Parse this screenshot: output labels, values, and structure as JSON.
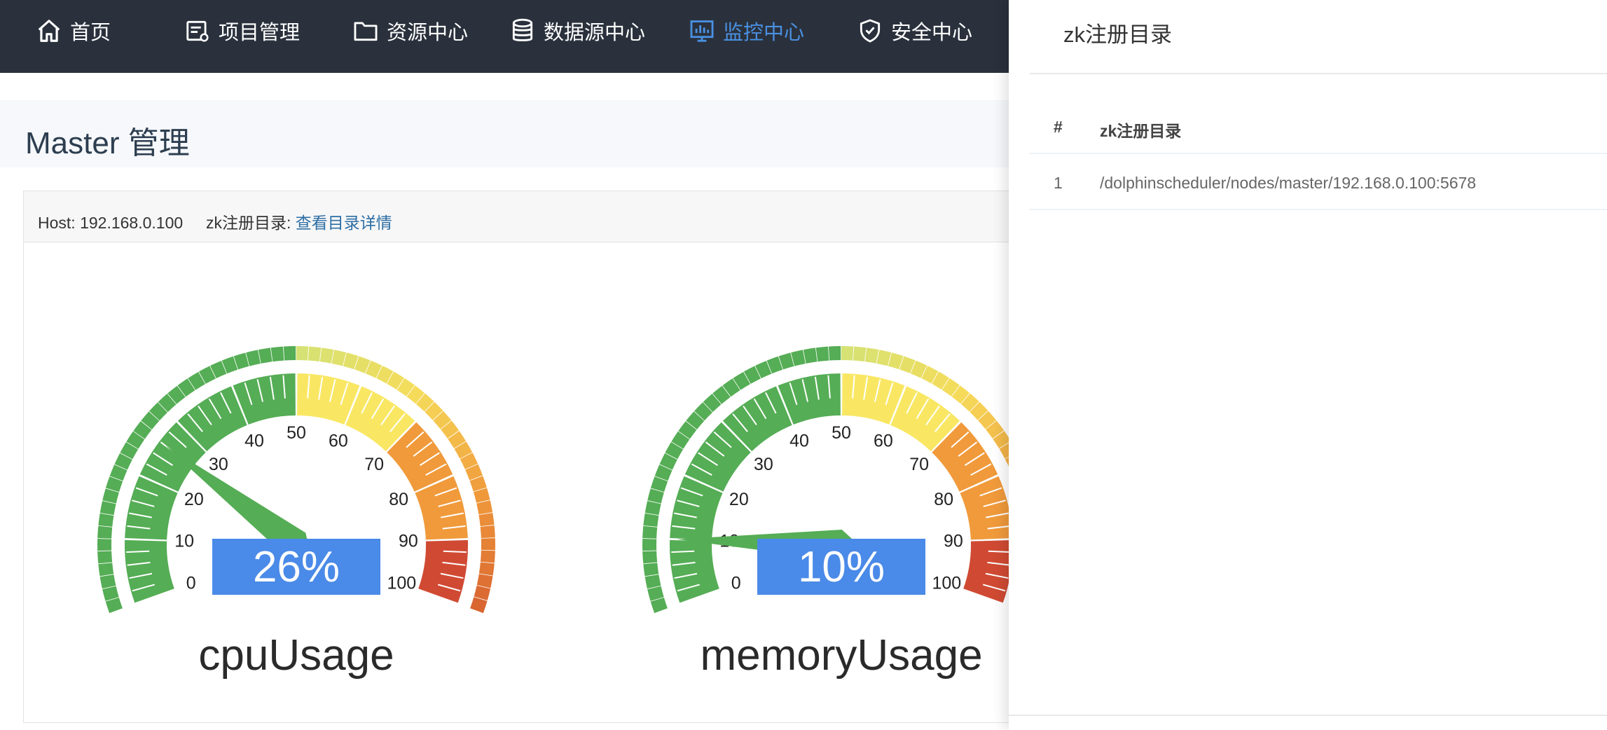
{
  "nav": {
    "items": [
      {
        "label": "首页",
        "icon": "home-icon"
      },
      {
        "label": "项目管理",
        "icon": "project-icon"
      },
      {
        "label": "资源中心",
        "icon": "folder-icon"
      },
      {
        "label": "数据源中心",
        "icon": "database-icon"
      },
      {
        "label": "监控中心",
        "icon": "monitor-icon",
        "active": true
      },
      {
        "label": "安全中心",
        "icon": "shield-icon"
      }
    ],
    "active_color": "#4a90e2",
    "background": "#2a313c"
  },
  "page": {
    "title": "Master 管理"
  },
  "master": {
    "host_label": "Host:",
    "host_value": "192.168.0.100",
    "zk_label": "zk注册目录:",
    "zk_link": "查看目录详情"
  },
  "gauges": [
    {
      "name": "cpuUsage",
      "value": 26,
      "value_text": "26%"
    },
    {
      "name": "memoryUsage",
      "value": 10,
      "value_text": "10%"
    }
  ],
  "gauge_ticks": [
    "0",
    "10",
    "20",
    "30",
    "40",
    "50",
    "60",
    "70",
    "80",
    "90",
    "100"
  ],
  "gauge_colors": {
    "low": "#55ad55",
    "mid": "#f9e764",
    "high": "#f09a3b",
    "critical": "#d04a33",
    "value_box": "#4a8ae8"
  },
  "drawer": {
    "title": "zk注册目录",
    "table": {
      "headers": [
        "#",
        "zk注册目录"
      ],
      "rows": [
        [
          "1",
          "/dolphinscheduler/nodes/master/192.168.0.100:5678"
        ]
      ]
    }
  }
}
